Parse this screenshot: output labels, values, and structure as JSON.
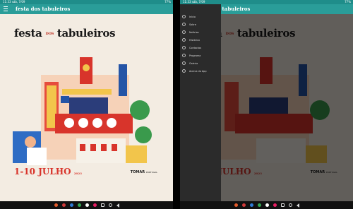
{
  "status": {
    "time": "11:33",
    "info": "sáb, 7/09",
    "battery": "77%"
  },
  "app": {
    "title": "festa dos tabuleiros"
  },
  "poster": {
    "title_a": "festa",
    "title_dos": "DOS",
    "title_b": "tabuleiros",
    "date": "1-10 JULHO",
    "year": "2023",
    "place": "TOMAR",
    "country": "PORTUGAL"
  },
  "drawer": {
    "items": [
      {
        "label": "Início",
        "icon": "home-icon"
      },
      {
        "label": "Sobre",
        "icon": "info-icon"
      },
      {
        "label": "Notícias",
        "icon": "news-icon"
      },
      {
        "label": "Histórico",
        "icon": "history-icon"
      },
      {
        "label": "Contactos",
        "icon": "contact-icon"
      },
      {
        "label": "Programa",
        "icon": "calendar-icon"
      },
      {
        "label": "Galeria",
        "icon": "gallery-icon"
      },
      {
        "label": "Acerca da App",
        "icon": "about-icon"
      }
    ]
  },
  "dock": {
    "apps": [
      "app-1",
      "app-2",
      "app-3",
      "app-4",
      "app-5",
      "app-6",
      "app-7"
    ],
    "colors": [
      "#e45b2b",
      "#d23b3b",
      "#2e7bd6",
      "#34a853",
      "#ffffff",
      "#e91e63",
      "#7e57c2"
    ]
  }
}
